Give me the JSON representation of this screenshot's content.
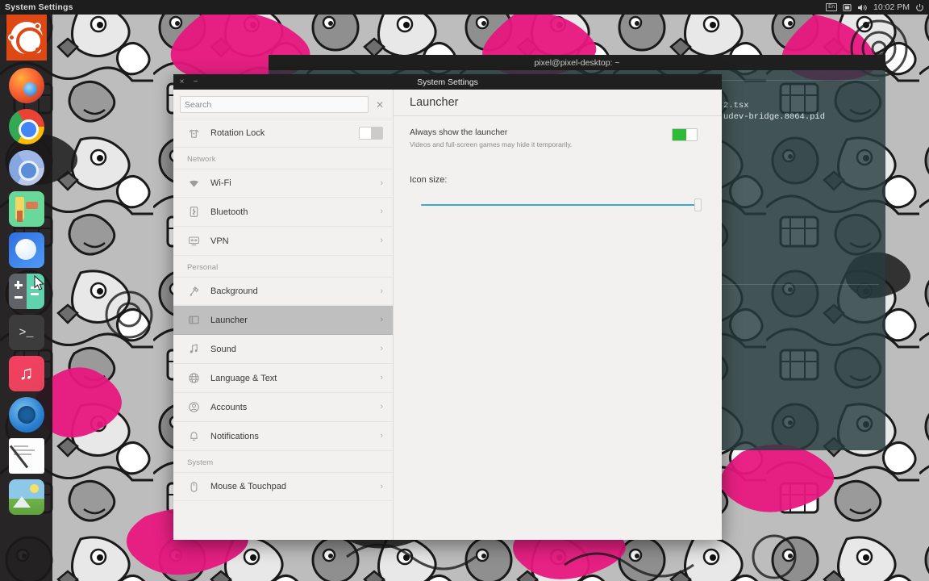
{
  "top_panel": {
    "title": "System Settings",
    "tray": {
      "keyboard_layout": "En",
      "display_icon": "display-icon",
      "volume_icon": "volume-icon",
      "clock": "10:02 PM",
      "power_icon": "power-icon"
    }
  },
  "dock": {
    "items": [
      {
        "name": "ubuntu-dash-icon",
        "label": "Ubuntu Dash"
      },
      {
        "name": "firefox-icon",
        "label": "Firefox"
      },
      {
        "name": "chrome-icon",
        "label": "Google Chrome"
      },
      {
        "name": "chromium-icon",
        "label": "Chromium"
      },
      {
        "name": "game-icon",
        "label": "Game"
      },
      {
        "name": "files-icon",
        "label": "Files"
      },
      {
        "name": "calculator-icon",
        "label": "Calculator"
      },
      {
        "name": "terminal-icon",
        "label": "Terminal"
      },
      {
        "name": "music-icon",
        "label": "Music"
      },
      {
        "name": "blue-app-icon",
        "label": "Blue App"
      },
      {
        "name": "text-editor-icon",
        "label": "Text Editor"
      },
      {
        "name": "image-viewer-icon",
        "label": "Image Viewer"
      }
    ]
  },
  "terminal": {
    "title": "pixel@pixel-desktop: ~",
    "lines_top": [
      "",
      ""
    ],
    "lines": [
      "2.tsx",
      "udev-bridge.8064.pid"
    ]
  },
  "settings_window": {
    "title": "System Settings",
    "close_label": "×",
    "minimize_label": "−",
    "search": {
      "placeholder": "Search",
      "value": "",
      "clear_label": "✕"
    },
    "sidebar": {
      "groups": [
        {
          "header": "",
          "items": [
            {
              "label": "Rotation Lock",
              "icon": "rotation-lock-icon",
              "control": "toggle",
              "toggle_on": false,
              "selected": false
            }
          ]
        },
        {
          "header": "Network",
          "items": [
            {
              "label": "Wi-Fi",
              "icon": "wifi-icon",
              "control": "chevron",
              "chevron": "›",
              "selected": false
            },
            {
              "label": "Bluetooth",
              "icon": "bluetooth-icon",
              "control": "chevron",
              "chevron": "›",
              "selected": false
            },
            {
              "label": "VPN",
              "icon": "vpn-icon",
              "control": "chevron",
              "chevron": "›",
              "selected": false
            }
          ]
        },
        {
          "header": "Personal",
          "items": [
            {
              "label": "Background",
              "icon": "background-icon",
              "control": "chevron",
              "chevron": "›",
              "selected": false
            },
            {
              "label": "Launcher",
              "icon": "launcher-icon",
              "control": "chevron",
              "chevron": "›",
              "selected": true
            },
            {
              "label": "Sound",
              "icon": "sound-icon",
              "control": "chevron",
              "chevron": "›",
              "selected": false
            },
            {
              "label": "Language & Text",
              "icon": "language-icon",
              "control": "chevron",
              "chevron": "›",
              "selected": false
            },
            {
              "label": "Accounts",
              "icon": "accounts-icon",
              "control": "chevron",
              "chevron": "›",
              "selected": false
            },
            {
              "label": "Notifications",
              "icon": "notifications-icon",
              "control": "chevron",
              "chevron": "›",
              "selected": false
            }
          ]
        },
        {
          "header": "System",
          "items": [
            {
              "label": "Mouse & Touchpad",
              "icon": "mouse-icon",
              "control": "chevron",
              "chevron": "›",
              "selected": false
            }
          ]
        }
      ]
    },
    "main": {
      "title": "Launcher",
      "always_show": {
        "title": "Always show the launcher",
        "subtitle": "Videos and full-screen games may hide it temporarily.",
        "toggle_on": true
      },
      "icon_size": {
        "label": "Icon size:",
        "value_percent": 97
      }
    }
  },
  "colors": {
    "accent_orange": "#dd4814",
    "toggle_green": "#2fbb3a",
    "slider_blue": "#3aa8cf",
    "selected_row": "#bfbfbf",
    "window_bg": "#f2f1f0",
    "panel_dark": "#1d1d1d"
  }
}
